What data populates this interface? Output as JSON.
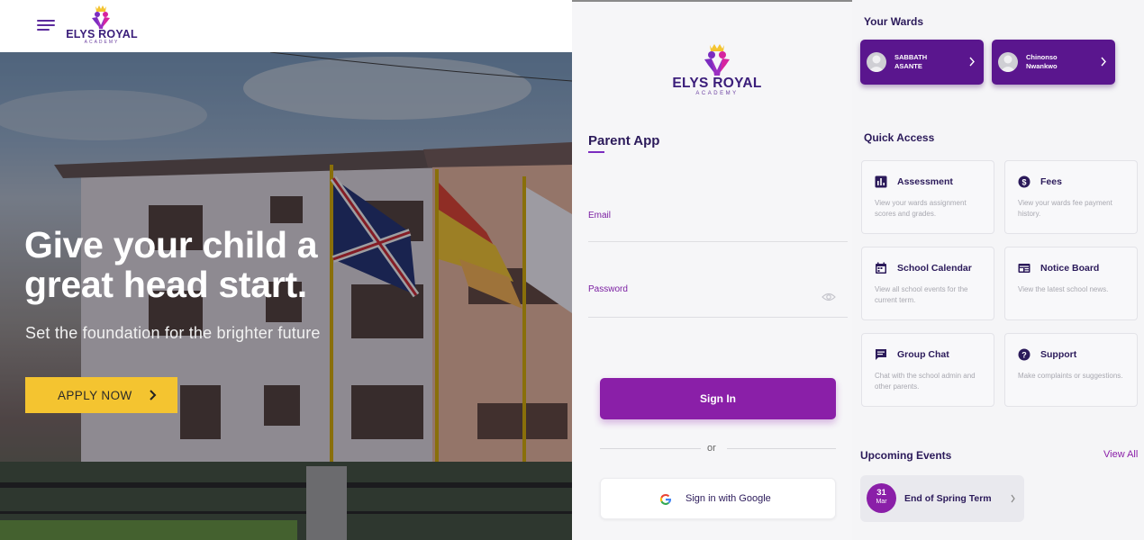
{
  "brand": {
    "name": "ELYS ROYAL",
    "tagline": "ACADEMY",
    "purple": "#5b2a9c",
    "accent": "#8a1fa8",
    "yellow": "#f4c430"
  },
  "landing": {
    "menu_icon": "hamburger-icon",
    "headline": "Give your child a great head start.",
    "subheadline": "Set the foundation for the brighter future",
    "apply_label": "APPLY NOW",
    "apply_icon": "chevron-right-icon"
  },
  "login": {
    "title": "Parent App",
    "email_label": "Email",
    "email_value": "",
    "password_label": "Password",
    "password_value": "",
    "password_icon": "eye-icon",
    "signin_label": "Sign In",
    "or_label": "or",
    "google_label": "Sign in with Google",
    "google_icon": "google-icon"
  },
  "dashboard": {
    "wards_title": "Your Wards",
    "wards": [
      {
        "name_line1": "SABBATH",
        "name_line2": "ASANTE"
      },
      {
        "name_line1": "Chinonso",
        "name_line2": "Nwankwo"
      }
    ],
    "quick_access_title": "Quick Access",
    "quick_access": [
      {
        "icon": "bar-chart-icon",
        "title": "Assessment",
        "desc": "View your wards assignment scores and grades."
      },
      {
        "icon": "dollar-circle-icon",
        "title": "Fees",
        "desc": "View your wards fee payment history."
      },
      {
        "icon": "calendar-icon",
        "title": "School Calendar",
        "desc": "View all school events for the current term."
      },
      {
        "icon": "notice-board-icon",
        "title": "Notice Board",
        "desc": "View the latest school news."
      },
      {
        "icon": "chat-icon",
        "title": "Group Chat",
        "desc": "Chat with the school admin and other parents."
      },
      {
        "icon": "help-circle-icon",
        "title": "Support",
        "desc": "Make complaints or suggestions."
      }
    ],
    "events_title": "Upcoming Events",
    "view_all_label": "View All",
    "events": [
      {
        "day": "31",
        "month": "Mar",
        "title": "End of Spring Term"
      }
    ]
  }
}
